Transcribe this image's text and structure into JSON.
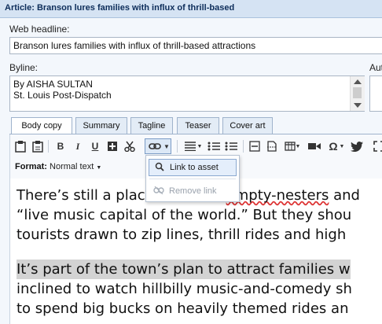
{
  "window": {
    "title": "Article: Branson lures families with influx of thrill-based"
  },
  "headline": {
    "label": "Web headline:",
    "value": "Branson lures families with influx of thrill-based attractions"
  },
  "byline": {
    "label": "Byline:",
    "line1": "By AISHA SULTAN",
    "line2": "St. Louis Post-Dispatch"
  },
  "author_label": "Aut",
  "tabs": [
    "Body copy",
    "Summary",
    "Tagline",
    "Teaser",
    "Cover art"
  ],
  "toolbar": {
    "bold": "B",
    "italic": "I",
    "underline": "U",
    "omega": "Ω"
  },
  "format": {
    "label": "Format:",
    "value": "Normal text"
  },
  "link_menu": {
    "items": [
      {
        "label": "Link to asset",
        "icon": "search-icon"
      },
      {
        "label": "Remove link",
        "icon": "unlink-icon"
      }
    ]
  },
  "body": {
    "p1": [
      "There’s still a plac",
      "empty-nesters and",
      "“live music capital of the world.” But they shou",
      "tourists drawn to zip lines, thrill rides and high"
    ],
    "p2": [
      "It’s part of the town’s plan to attract families w",
      "inclined to watch hillbilly music-and-comedy sh",
      "to spend big bucks on heavily themed rides an"
    ]
  }
}
